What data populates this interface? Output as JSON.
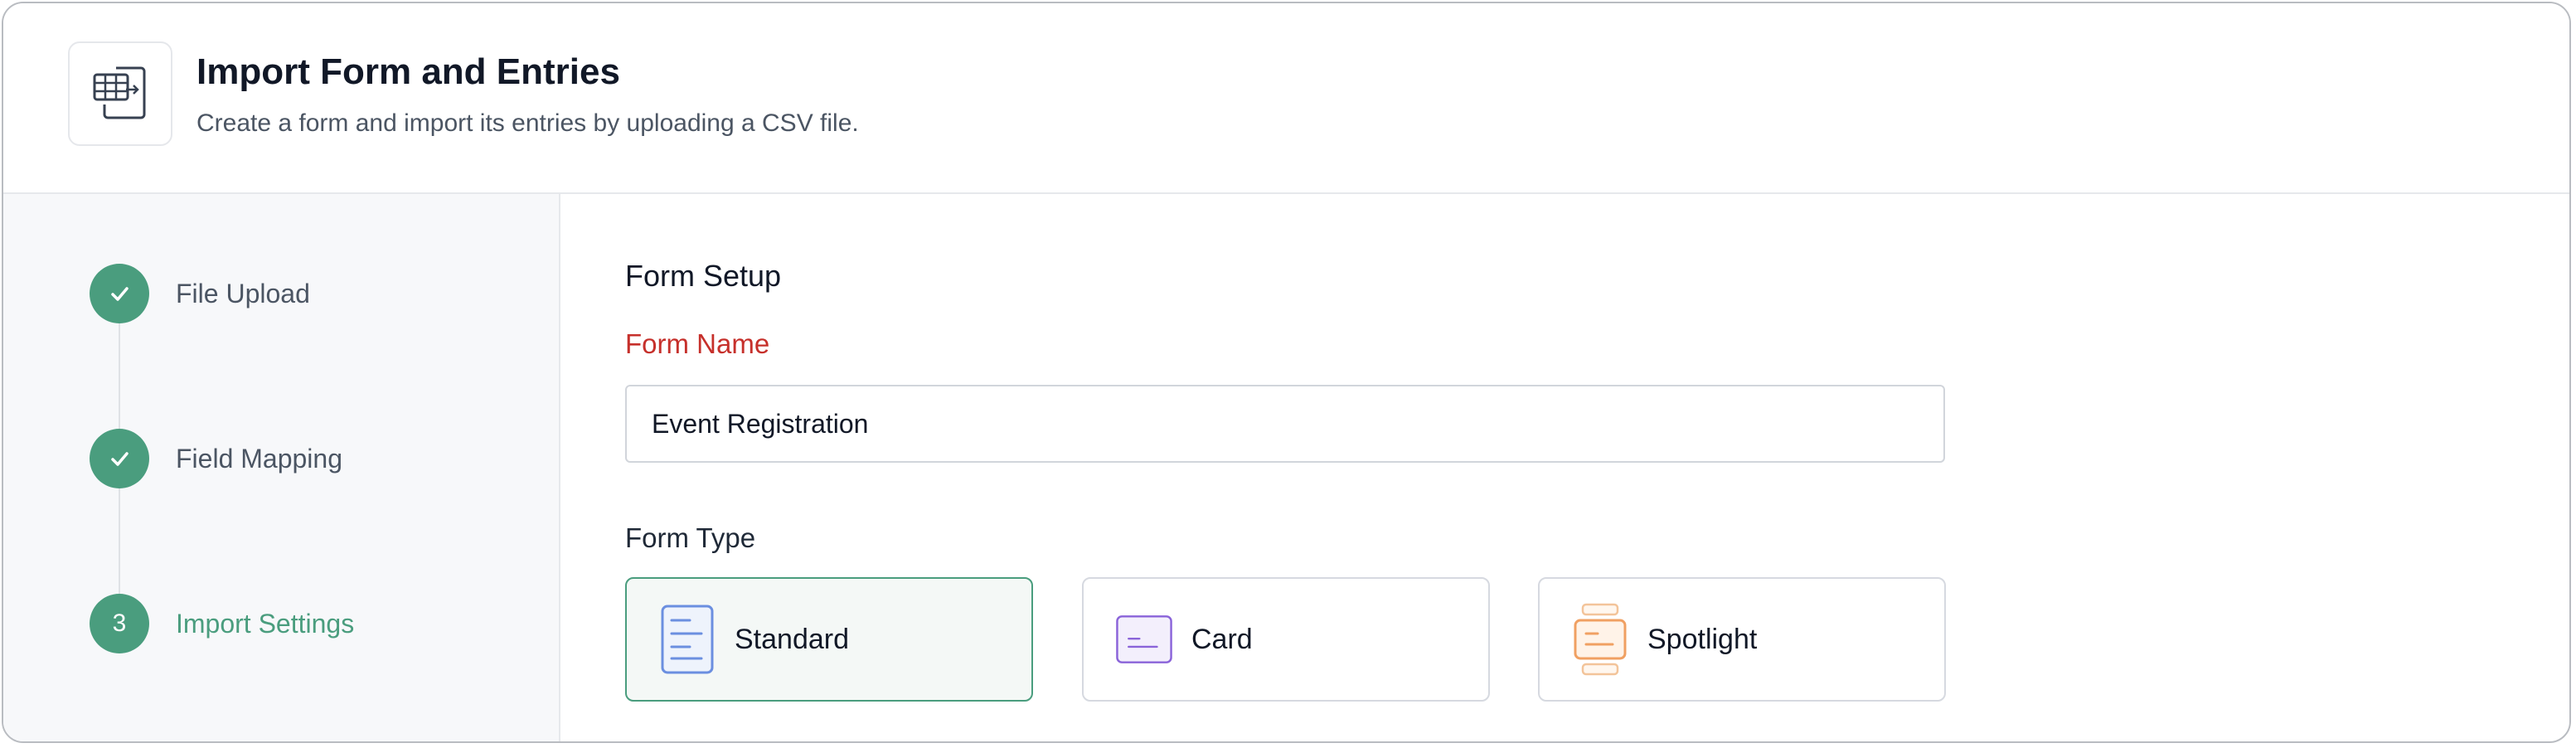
{
  "header": {
    "title": "Import Form and Entries",
    "subtitle": "Create a form and import its entries by uploading a CSV file.",
    "icon": "table-import-icon"
  },
  "steps": [
    {
      "label": "File Upload",
      "state": "complete",
      "marker": ""
    },
    {
      "label": "Field Mapping",
      "state": "complete",
      "marker": ""
    },
    {
      "label": "Import Settings",
      "state": "active",
      "marker": "3"
    }
  ],
  "form_setup": {
    "section_title": "Form Setup",
    "form_name_label": "Form Name",
    "form_name_value": "Event Registration",
    "form_type_label": "Form Type",
    "types": [
      {
        "label": "Standard",
        "icon": "standard-form-icon",
        "selected": true
      },
      {
        "label": "Card",
        "icon": "card-form-icon",
        "selected": false
      },
      {
        "label": "Spotlight",
        "icon": "spotlight-form-icon",
        "selected": false
      }
    ]
  },
  "colors": {
    "accent": "#4a9d7e",
    "required_label": "#c6302b",
    "standard_icon": "#6b8fe0",
    "card_icon": "#8a63d9",
    "spotlight_icon": "#f0a062"
  }
}
